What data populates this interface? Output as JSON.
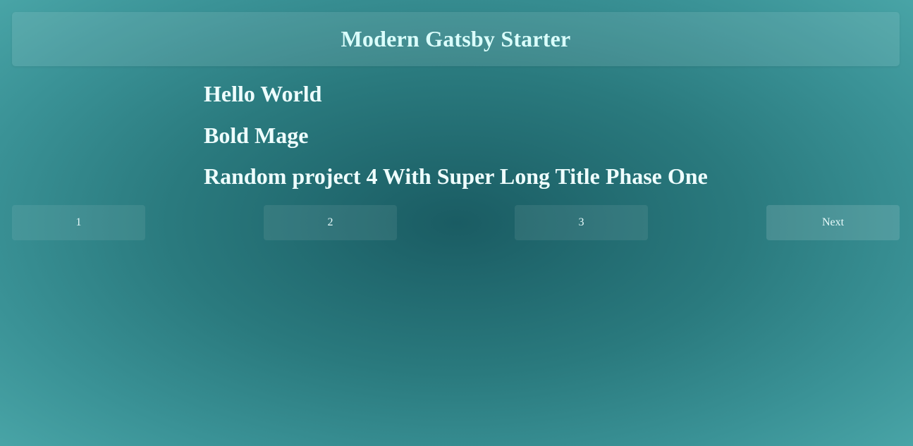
{
  "header": {
    "title": "Modern Gatsby Starter"
  },
  "posts": [
    {
      "title": "Hello World"
    },
    {
      "title": "Bold Mage"
    },
    {
      "title": "Random project 4 With Super Long Title Phase One"
    }
  ],
  "pagination": {
    "pages": [
      "1",
      "2",
      "3"
    ],
    "next_label": "Next"
  },
  "colors": {
    "background_center": "#1a5c63",
    "background_edge": "#4aa6a8",
    "text": "#e8fbfb"
  }
}
